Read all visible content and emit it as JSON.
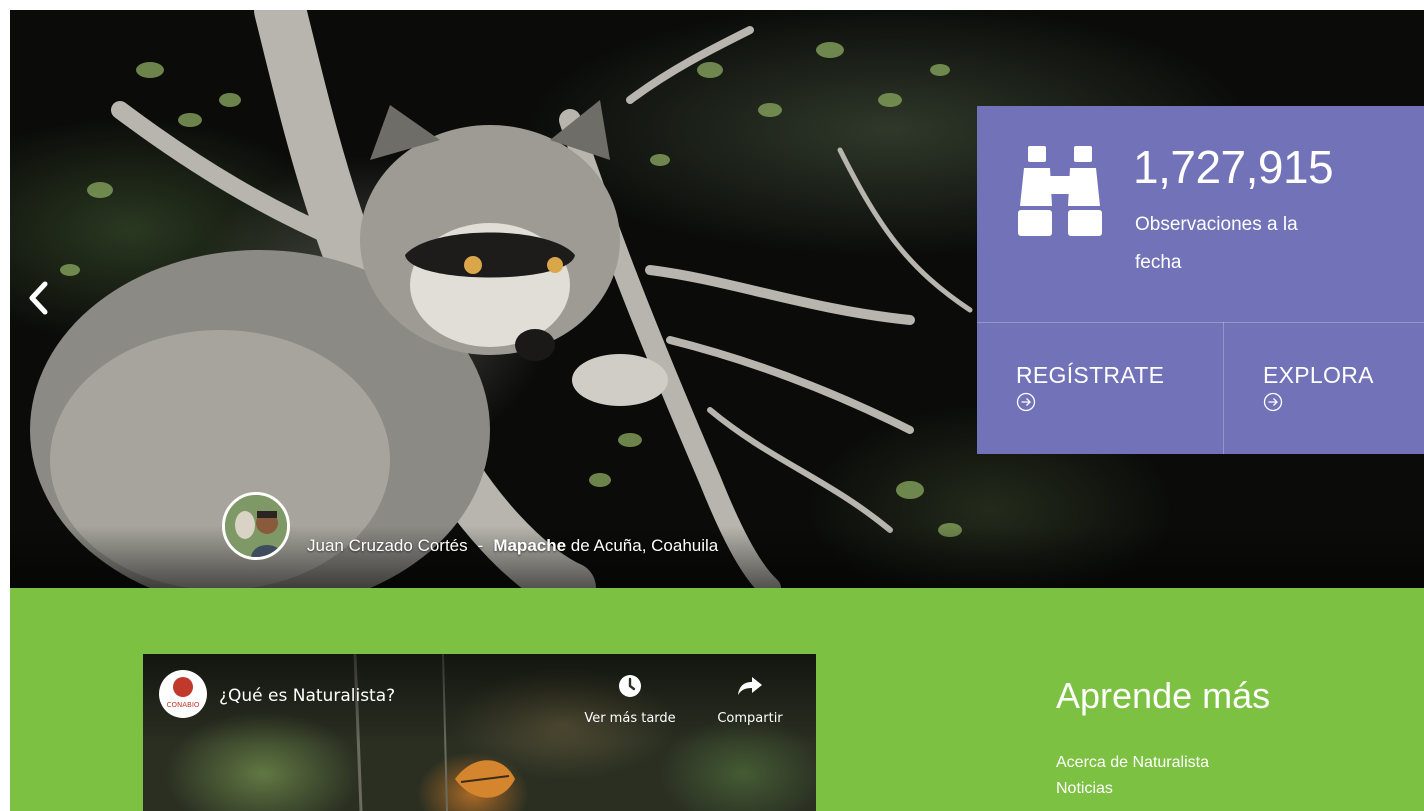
{
  "hero": {
    "photographer": "Juan Cruzado Cortés",
    "separator": "-",
    "taxon": "Mapache",
    "place": "de Acuña, Coahuila"
  },
  "stats": {
    "count": "1,727,915",
    "label": "Observaciones a la fecha",
    "register_label": "REGÍSTRATE",
    "explore_label": "EXPLORA"
  },
  "video": {
    "channel": "CONABIO",
    "title": "¿Qué es Naturalista?",
    "watch_later": "Ver más tarde",
    "share": "Compartir"
  },
  "learn": {
    "heading": "Aprende más",
    "links": [
      "Acerca de Naturalista",
      "Noticias"
    ]
  },
  "colors": {
    "stats_panel": "#7272b9",
    "green_band": "#7cc142"
  },
  "icons": [
    "chevron-left-icon",
    "binoculars-icon",
    "arrow-circle-right-icon",
    "clock-icon",
    "share-arrow-icon"
  ]
}
